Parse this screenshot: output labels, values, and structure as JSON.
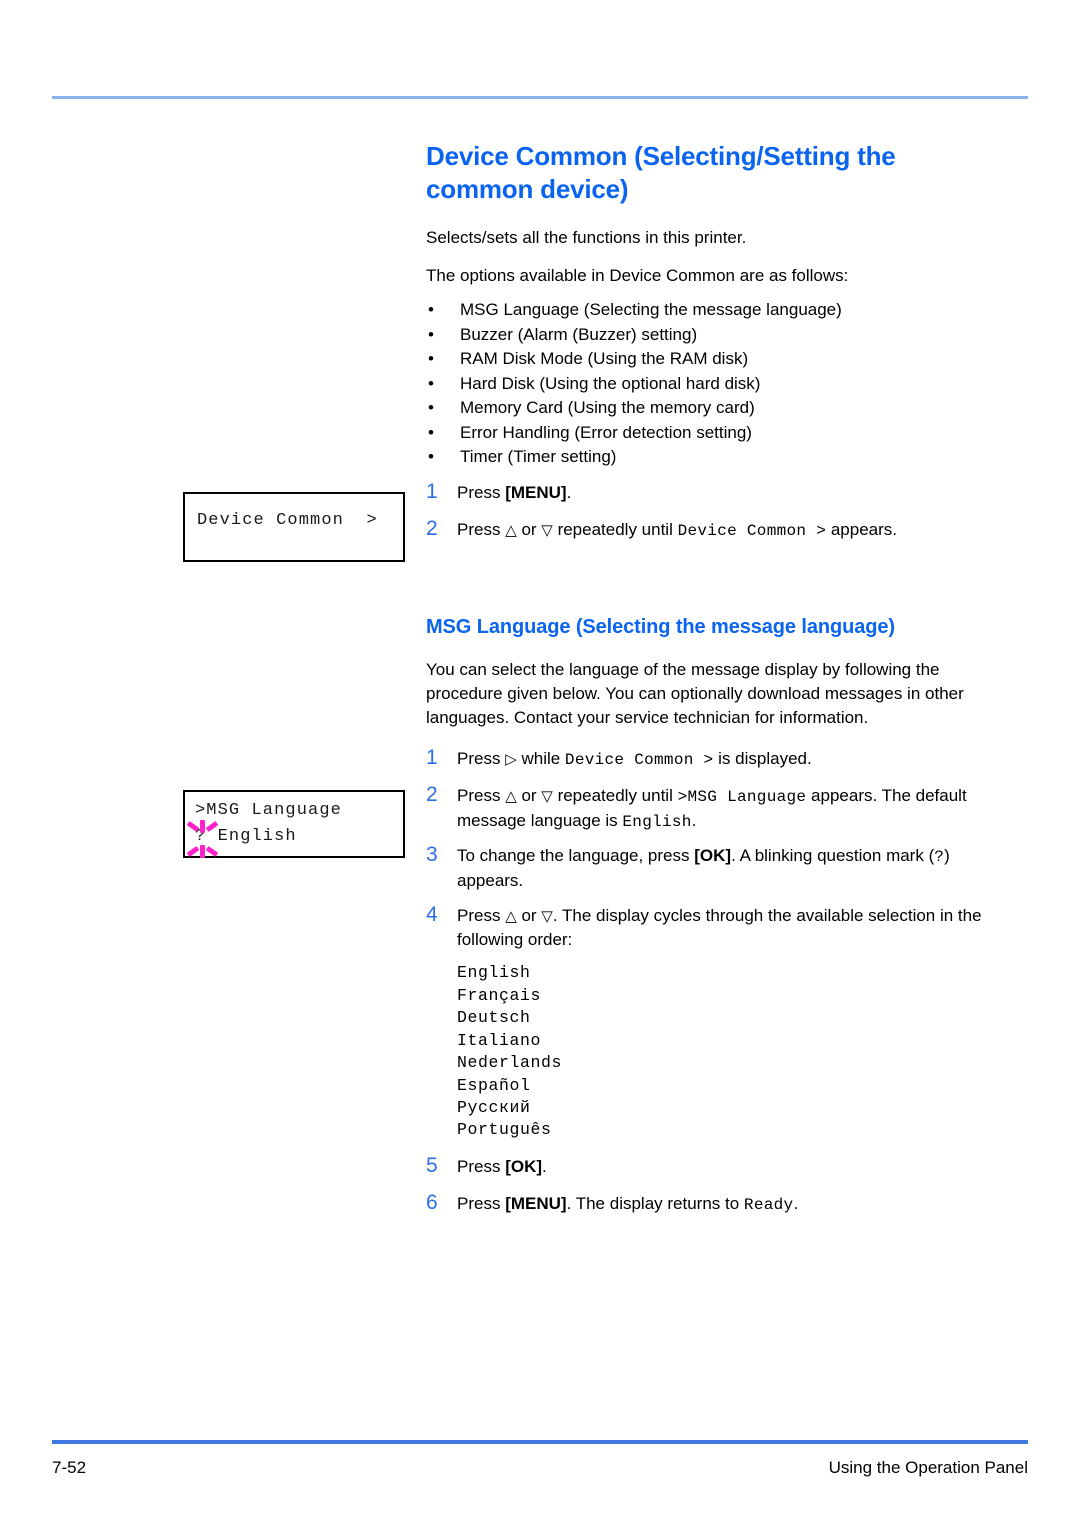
{
  "page": {
    "footer_page_number": "7-52",
    "footer_title": "Using the Operation Panel",
    "accent_color": "#0a64f0",
    "rule_top_color": "#88b4f0",
    "rule_bottom_color": "#3f77e0",
    "blink_color": "#ff21cc"
  },
  "section": {
    "title": "Device Common (Selecting/Setting the common device)",
    "intro_1": "Selects/sets all the functions in this printer.",
    "intro_2": "The options available in Device Common are as follows:",
    "bullet_marker": "•",
    "bullets": [
      "MSG Language (Selecting the message language)",
      "Buzzer (Alarm (Buzzer) setting)",
      "RAM Disk Mode (Using the RAM disk)",
      "Hard Disk (Using the optional hard disk)",
      "Memory Card (Using the memory card)",
      "Error Handling (Error detection setting)",
      "Timer (Timer setting)"
    ],
    "steps": [
      {
        "number": "1",
        "parts": [
          {
            "t": "Press ",
            "s": "plain"
          },
          {
            "t": "[MENU]",
            "s": "bold"
          },
          {
            "t": ".",
            "s": "plain"
          }
        ]
      },
      {
        "number": "2",
        "parts": [
          {
            "t": "Press ",
            "s": "plain"
          },
          {
            "t": "△",
            "s": "tri"
          },
          {
            "t": " or ",
            "s": "plain"
          },
          {
            "t": "▽",
            "s": "tri"
          },
          {
            "t": " repeatedly until ",
            "s": "plain"
          },
          {
            "t": "Device Common >",
            "s": "mono"
          },
          {
            "t": " appears.",
            "s": "plain"
          }
        ]
      }
    ]
  },
  "subsection": {
    "title": "MSG Language (Selecting the message language)",
    "intro": "You can select the language of the message display by following the procedure given below. You can optionally download messages in other languages. Contact your service technician for information.",
    "steps": [
      {
        "number": "1",
        "parts": [
          {
            "t": "Press ",
            "s": "plain"
          },
          {
            "t": "▷",
            "s": "tri"
          },
          {
            "t": " while ",
            "s": "plain"
          },
          {
            "t": "Device Common >",
            "s": "mono"
          },
          {
            "t": " is displayed.",
            "s": "plain"
          }
        ]
      },
      {
        "number": "2",
        "parts": [
          {
            "t": "Press ",
            "s": "plain"
          },
          {
            "t": "△",
            "s": "tri"
          },
          {
            "t": " or ",
            "s": "plain"
          },
          {
            "t": "▽",
            "s": "tri"
          },
          {
            "t": " repeatedly until ",
            "s": "plain"
          },
          {
            "t": ">MSG Language",
            "s": "mono"
          },
          {
            "t": " appears. The default message language is ",
            "s": "plain"
          },
          {
            "t": "English",
            "s": "mono"
          },
          {
            "t": ".",
            "s": "plain"
          }
        ]
      },
      {
        "number": "3",
        "parts": [
          {
            "t": "To change the language, press ",
            "s": "plain"
          },
          {
            "t": "[OK]",
            "s": "bold"
          },
          {
            "t": ". A blinking question mark (",
            "s": "plain"
          },
          {
            "t": "?",
            "s": "mono"
          },
          {
            "t": ") appears.",
            "s": "plain"
          }
        ]
      },
      {
        "number": "4",
        "parts": [
          {
            "t": "Press ",
            "s": "plain"
          },
          {
            "t": "△",
            "s": "tri"
          },
          {
            "t": " or ",
            "s": "plain"
          },
          {
            "t": "▽",
            "s": "tri"
          },
          {
            "t": ". The display cycles through the available selection in the following order:",
            "s": "plain"
          }
        ]
      }
    ],
    "languages": [
      "English",
      "Français",
      "Deutsch",
      "Italiano",
      "Nederlands",
      "Español",
      "Русский",
      "Português"
    ],
    "steps_after": [
      {
        "number": "5",
        "parts": [
          {
            "t": "Press ",
            "s": "plain"
          },
          {
            "t": "[OK]",
            "s": "bold"
          },
          {
            "t": ".",
            "s": "plain"
          }
        ]
      },
      {
        "number": "6",
        "parts": [
          {
            "t": "Press ",
            "s": "plain"
          },
          {
            "t": "[MENU]",
            "s": "bold"
          },
          {
            "t": ". The display returns to ",
            "s": "plain"
          },
          {
            "t": "Ready",
            "s": "mono"
          },
          {
            "t": ".",
            "s": "plain"
          }
        ]
      }
    ]
  },
  "lcd_panels": {
    "panel_1": {
      "line_1": "Device Common  >",
      "line_2": ""
    },
    "panel_2": {
      "line_1": ">MSG Language",
      "line_2": "? English",
      "blinking_character": "?"
    }
  }
}
